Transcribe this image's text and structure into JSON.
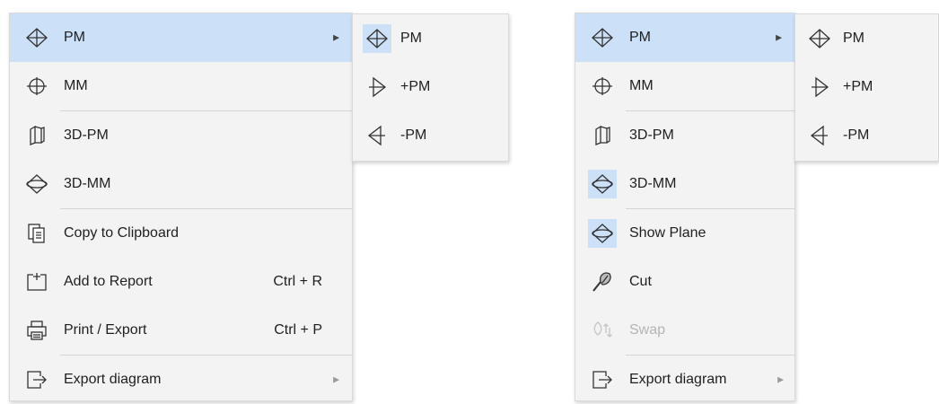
{
  "left_menu": {
    "items": [
      {
        "label": "PM",
        "icon": "pm-icon"
      },
      {
        "label": "MM",
        "icon": "mm-icon"
      },
      {
        "label": "3D-PM",
        "icon": "3d-pm-icon"
      },
      {
        "label": "3D-MM",
        "icon": "3d-mm-icon"
      },
      {
        "label": "Copy to Clipboard",
        "icon": "clipboard-icon"
      },
      {
        "label": "Add to Report",
        "shortcut": "Ctrl + R",
        "icon": "add-report-icon"
      },
      {
        "label": "Print / Export",
        "shortcut": "Ctrl + P",
        "icon": "printer-icon"
      },
      {
        "label": "Export diagram",
        "icon": "export-icon"
      }
    ]
  },
  "left_submenu": {
    "items": [
      {
        "label": "PM",
        "icon": "pm-icon"
      },
      {
        "label": "+PM",
        "icon": "plus-pm-icon"
      },
      {
        "label": "-PM",
        "icon": "minus-pm-icon"
      }
    ]
  },
  "right_menu": {
    "items": [
      {
        "label": "PM",
        "icon": "pm-icon"
      },
      {
        "label": "MM",
        "icon": "mm-icon"
      },
      {
        "label": "3D-PM",
        "icon": "3d-pm-icon"
      },
      {
        "label": "3D-MM",
        "icon": "3d-mm-icon"
      },
      {
        "label": "Show Plane",
        "icon": "show-plane-icon"
      },
      {
        "label": "Cut",
        "icon": "cut-icon"
      },
      {
        "label": "Swap",
        "icon": "swap-icon",
        "disabled": true
      },
      {
        "label": "Export diagram",
        "icon": "export-icon"
      }
    ]
  },
  "right_submenu": {
    "items": [
      {
        "label": "PM",
        "icon": "pm-icon"
      },
      {
        "label": "+PM",
        "icon": "plus-pm-icon"
      },
      {
        "label": "-PM",
        "icon": "minus-pm-icon"
      }
    ]
  },
  "colors": {
    "highlight": "#cce0f7",
    "menu_bg": "#f3f3f3",
    "disabled_text": "#b4b4b4"
  }
}
